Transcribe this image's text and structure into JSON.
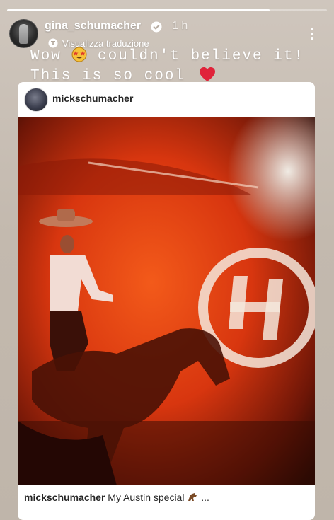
{
  "story": {
    "progress": 0.82,
    "author": {
      "username": "gina_schumacher",
      "verified": true,
      "time": "1 h"
    },
    "translate_label": "Visualizza traduzione",
    "caption_line1": "Wow",
    "caption_line1b": "couldn't believe it!",
    "caption_line2": "This is so cool",
    "icons": {
      "verified": "verified-badge-icon",
      "translate": "translate-icon",
      "more": "more-options-icon",
      "star_emoji": "star-struck-emoji-icon",
      "heart_emoji": "red-heart-emoji-icon"
    }
  },
  "shared_post": {
    "username": "mickschumacher",
    "caption_user": "mickschumacher",
    "caption_text": "My Austin special",
    "caption_suffix": "...",
    "icons": {
      "horse_emoji": "horse-emoji-icon"
    }
  }
}
